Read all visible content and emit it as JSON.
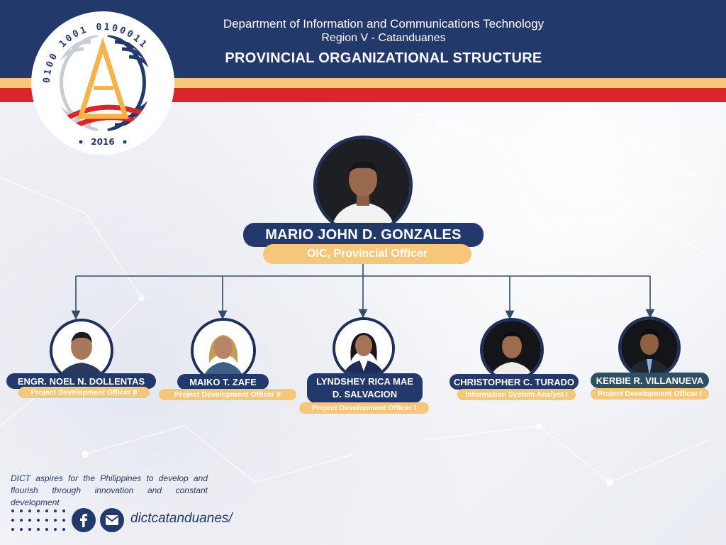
{
  "header": {
    "line1": "Department of Information and Communications Technology",
    "line2": "Region V - Catanduanes",
    "title": "PROVINCIAL ORGANIZATIONAL STRUCTURE"
  },
  "logo": {
    "year": "2016",
    "binary_text": "01001001 01000011 01010100 01000000",
    "icon": "dict-seal-logo"
  },
  "head": {
    "name": "MARIO JOHN D. GONZALES",
    "role": "OIC, Provincial Officer"
  },
  "staff": [
    {
      "name": "ENGR. NOEL N. DOLLENTAS",
      "role": "Project Development Officer II"
    },
    {
      "name": "MAIKO T. ZAFE",
      "role": "Project Development Officer II"
    },
    {
      "name_line1": "LYNDSHEY RICA MAE",
      "name_line2": "D. SALVACION",
      "role": "Project Development Officer I"
    },
    {
      "name": "CHRISTOPHER C. TURADO",
      "role": "Information System Analyst I"
    },
    {
      "name": "KERBIE R. VILLANUEVA",
      "role": "Project Development Officer I"
    }
  ],
  "footer": {
    "tagline": "DICT aspires for the Philippines to develop and flourish through innovation and constant development",
    "handle": "dictcatanduanes/",
    "icons": [
      "facebook-icon",
      "email-icon"
    ]
  },
  "colors": {
    "navy": "#23386b",
    "gold": "#f6c77a",
    "red": "#d9262c"
  }
}
